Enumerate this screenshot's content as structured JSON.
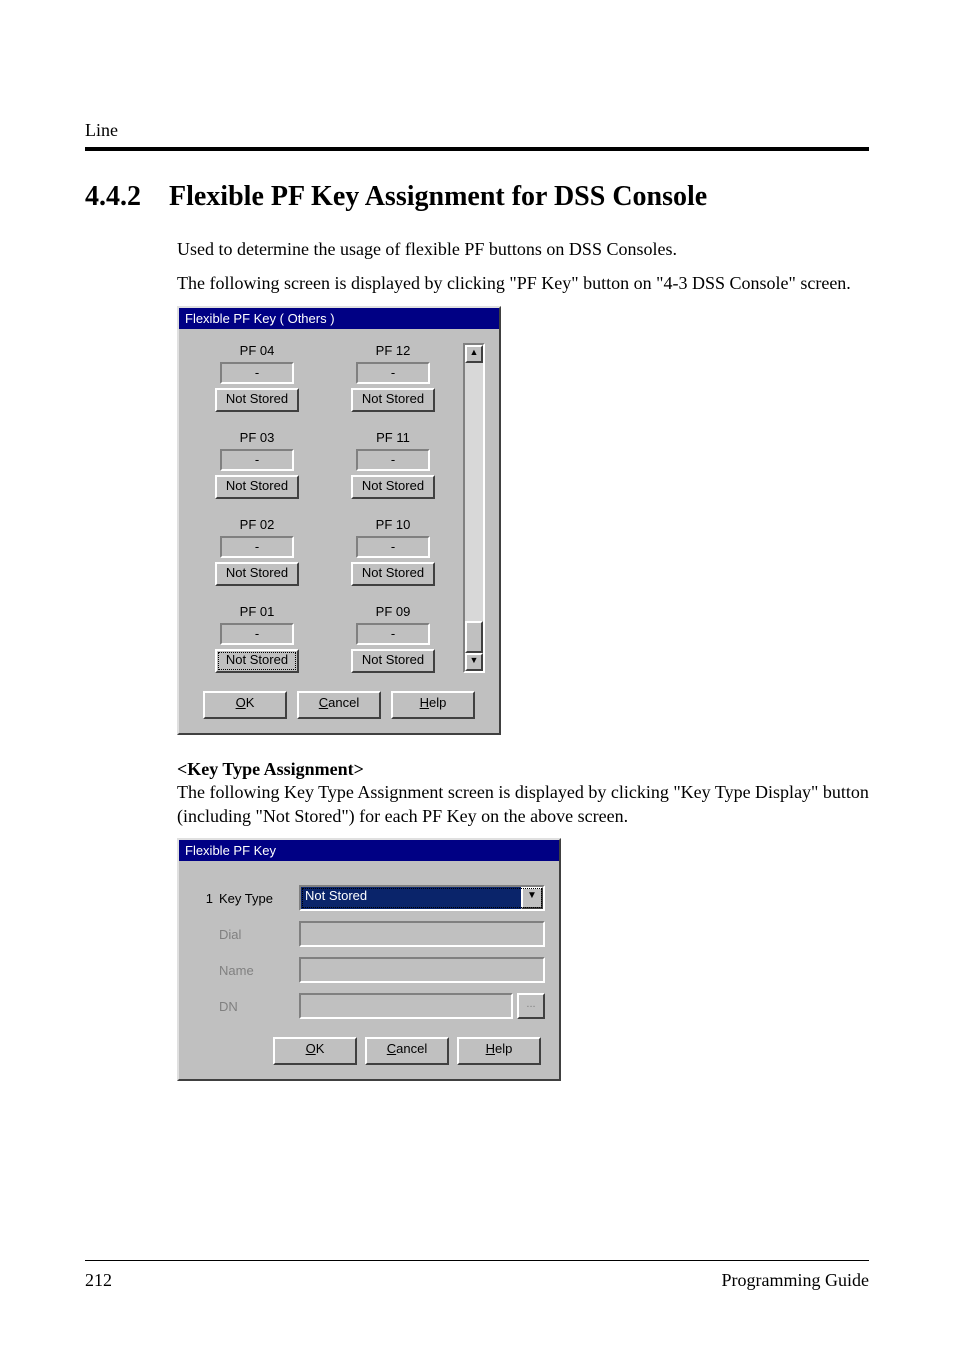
{
  "header_label": "Line",
  "section_number": "4.4.2",
  "section_title": "Flexible PF Key Assignment for DSS Console",
  "intro_line1": "Used to determine the usage of flexible PF buttons on DSS Consoles.",
  "intro_line2": "The following screen is displayed by clicking \"PF Key\" button on \"4-3 DSS Console\" screen.",
  "dialog1": {
    "title": "Flexible PF Key ( Others )",
    "pf_keys": [
      {
        "label": "PF 04",
        "value": "-",
        "type": "Not Stored",
        "focused": false
      },
      {
        "label": "PF 12",
        "value": "-",
        "type": "Not Stored",
        "focused": false
      },
      {
        "label": "PF 03",
        "value": "-",
        "type": "Not Stored",
        "focused": false
      },
      {
        "label": "PF 11",
        "value": "-",
        "type": "Not Stored",
        "focused": false
      },
      {
        "label": "PF 02",
        "value": "-",
        "type": "Not Stored",
        "focused": false
      },
      {
        "label": "PF 10",
        "value": "-",
        "type": "Not Stored",
        "focused": false
      },
      {
        "label": "PF 01",
        "value": "-",
        "type": "Not Stored",
        "focused": true
      },
      {
        "label": "PF 09",
        "value": "-",
        "type": "Not Stored",
        "focused": false
      }
    ],
    "buttons": {
      "ok": {
        "mnemonic": "O",
        "rest": "K"
      },
      "cancel": {
        "mnemonic": "C",
        "rest": "ancel"
      },
      "help": {
        "mnemonic": "H",
        "rest": "elp"
      }
    }
  },
  "subsection_heading": "<Key Type Assignment>",
  "subsection_text": "The following Key Type Assignment screen is displayed by clicking \"Key Type Display\" button (including \"Not Stored\") for each PF Key on the above screen.",
  "dialog2": {
    "title": "Flexible PF Key",
    "row_number": "1",
    "key_type_label": "Key Type",
    "key_type_value": "Not Stored",
    "dial_label": "Dial",
    "name_label": "Name",
    "dn_label": "DN",
    "browse_label": "...",
    "buttons": {
      "ok": {
        "mnemonic": "O",
        "rest": "K"
      },
      "cancel": {
        "mnemonic": "C",
        "rest": "ancel"
      },
      "help": {
        "mnemonic": "H",
        "rest": "elp"
      }
    }
  },
  "footer": {
    "page": "212",
    "doc": "Programming Guide"
  }
}
